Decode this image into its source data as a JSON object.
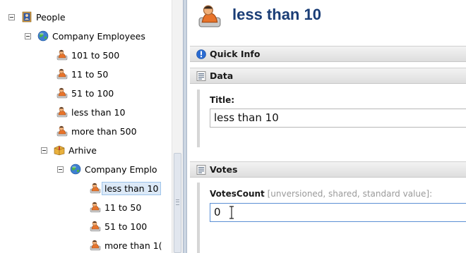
{
  "tree": {
    "items": [
      {
        "label": "People",
        "icon": "people-book-icon"
      },
      {
        "label": "Company Employees",
        "icon": "globe-icon"
      },
      {
        "label": "101 to 500",
        "icon": "person-orange-icon"
      },
      {
        "label": "11 to 50",
        "icon": "person-orange-icon"
      },
      {
        "label": "51 to 100",
        "icon": "person-orange-icon"
      },
      {
        "label": "less than 10",
        "icon": "person-orange-icon"
      },
      {
        "label": "more than 500",
        "icon": "person-orange-icon"
      },
      {
        "label": "Arhive",
        "icon": "box-icon"
      },
      {
        "label": "Company Emplo",
        "icon": "globe-icon"
      },
      {
        "label": "less than 10",
        "icon": "person-orange-icon",
        "selected": true
      },
      {
        "label": "11 to 50",
        "icon": "person-orange-icon"
      },
      {
        "label": "51 to 100",
        "icon": "person-orange-icon"
      },
      {
        "label": "more than 1(",
        "icon": "person-orange-icon"
      }
    ]
  },
  "editor": {
    "title": "less than 10",
    "sections": {
      "quick_info": "Quick Info",
      "data": "Data",
      "votes": "Votes"
    },
    "fields": {
      "title_label": "Title:",
      "title_value": "less than 10",
      "votes_label": "VotesCount",
      "votes_hint": " [unversioned, shared, standard value]:",
      "votes_value": "0"
    }
  },
  "colors": {
    "title_blue": "#1a3d76",
    "selection_bg": "#dce9f7",
    "focus_border": "#5b8fd4"
  }
}
